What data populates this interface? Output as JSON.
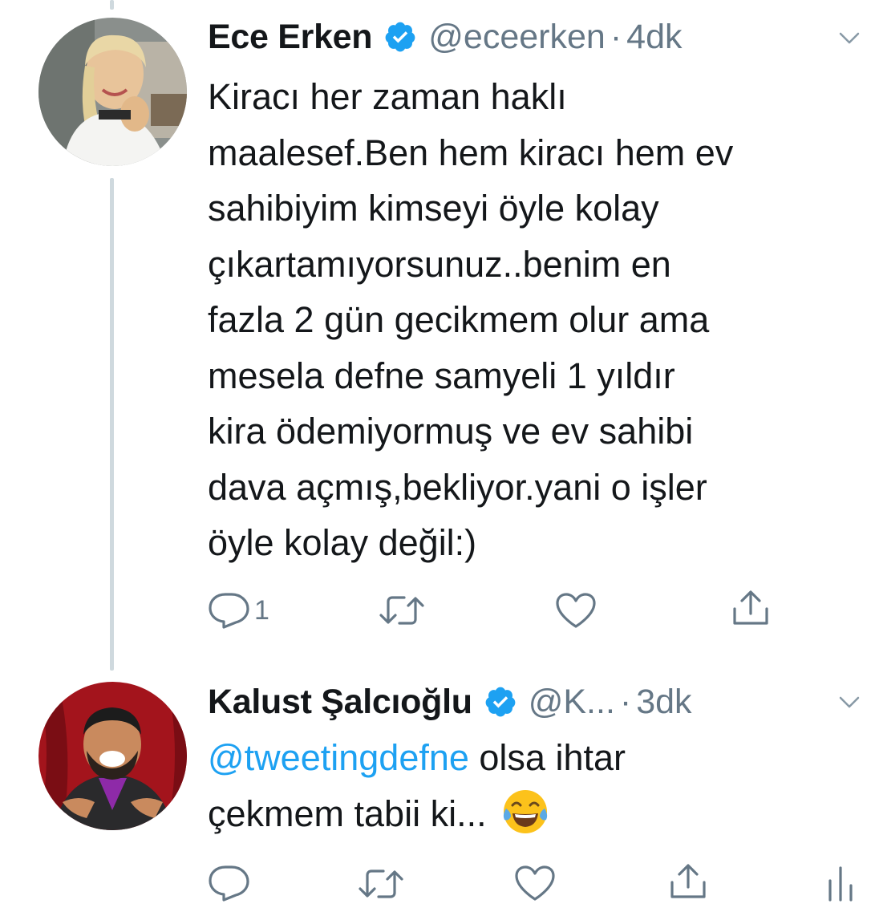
{
  "colors": {
    "text": "#14171a",
    "secondary": "#657786",
    "accent": "#1da1f2",
    "thread_line": "#cfd9de"
  },
  "tweets": [
    {
      "display_name": "Ece Erken",
      "handle": "@eceerken",
      "separator": "·",
      "time": "4dk",
      "verified": true,
      "text_lines": [
        "Kiracı her zaman haklı",
        "maalesef.Ben hem kiracı hem ev",
        "sahibiyim kimseyi öyle kolay",
        "çıkartamıyorsunuz..benim en",
        "fazla 2 gün gecikmem olur ama",
        "mesela defne samyeli 1 yıldır",
        "kira ödemiyormuş ve ev sahibi",
        "dava açmış,bekliyor.yani o işler",
        "öyle kolay değil:)"
      ],
      "reply_count": "1",
      "icons": [
        "reply-icon",
        "retweet-icon",
        "like-icon",
        "share-icon"
      ]
    },
    {
      "display_name": "Kalust Şalcıoğlu",
      "handle": "@K...",
      "separator": "·",
      "time": "3dk",
      "verified": true,
      "mention": "@tweetingdefne",
      "text_line1_rest": " olsa ihtar",
      "text_line2": "çekmem tabii ki... ",
      "emoji": "face-with-tears-of-joy",
      "icons": [
        "reply-icon",
        "retweet-icon",
        "like-icon",
        "share-icon",
        "analytics-icon"
      ]
    }
  ]
}
